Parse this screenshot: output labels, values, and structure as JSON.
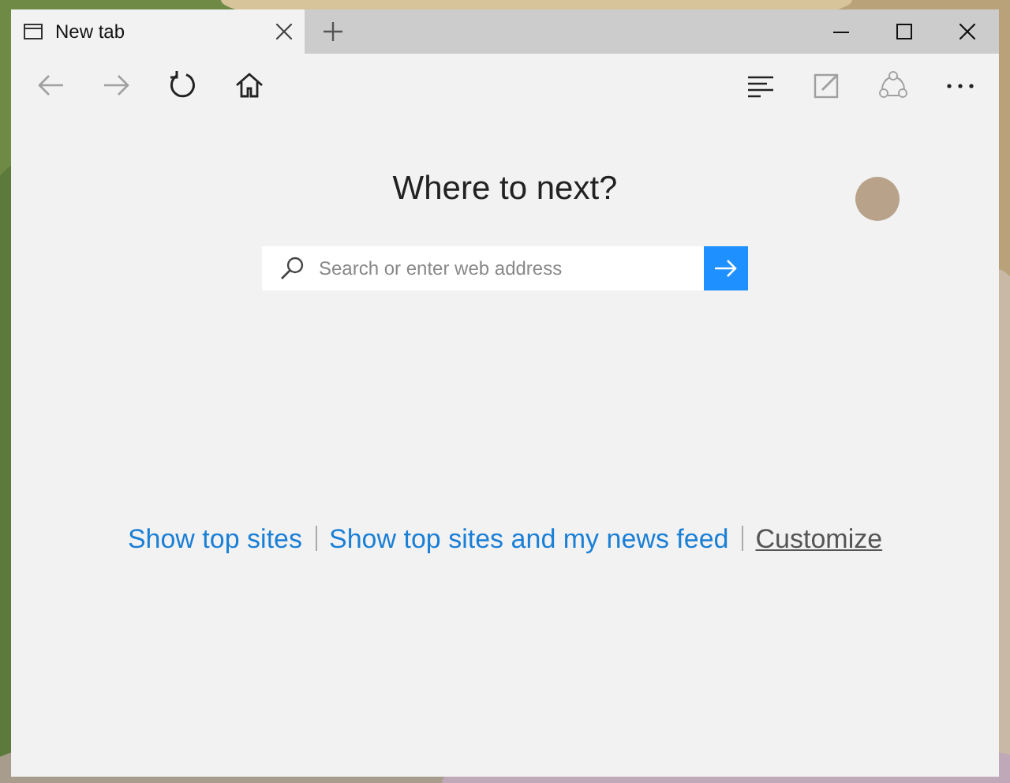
{
  "tabs": [
    {
      "label": "New tab",
      "selected": true
    }
  ],
  "nav_buttons": [
    {
      "kind": "back",
      "disabled": true
    },
    {
      "kind": "forward",
      "disabled": true
    },
    {
      "kind": "refresh",
      "disabled": false
    },
    {
      "kind": "home",
      "disabled": false
    }
  ],
  "tool_buttons": [
    {
      "kind": "hub",
      "disabled": false
    },
    {
      "kind": "note",
      "disabled": true
    },
    {
      "kind": "share",
      "disabled": true
    },
    {
      "kind": "more",
      "disabled": false
    }
  ],
  "heading": "Where to next?",
  "search": {
    "placeholder": "Search or enter web address"
  },
  "links": [
    {
      "label": "Show top sites",
      "kind": "link"
    },
    {
      "label": "Show top sites and my news feed",
      "kind": "link"
    },
    {
      "label": "Customize",
      "kind": "customize"
    }
  ]
}
